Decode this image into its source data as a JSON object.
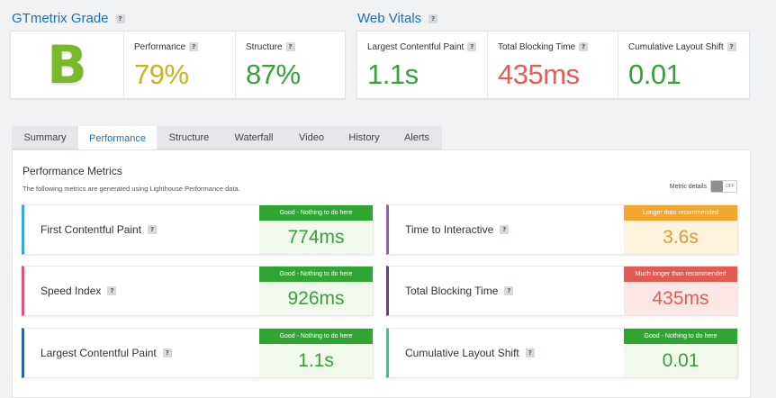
{
  "grade_section": {
    "title": "GTmetrix Grade",
    "help": "?",
    "grade": "B",
    "performance": {
      "label": "Performance",
      "value": "79%"
    },
    "structure": {
      "label": "Structure",
      "value": "87%"
    }
  },
  "web_vitals": {
    "title": "Web Vitals",
    "help": "?",
    "lcp": {
      "label": "Largest Contentful Paint",
      "value": "1.1s"
    },
    "tbt": {
      "label": "Total Blocking Time",
      "value": "435ms"
    },
    "cls": {
      "label": "Cumulative Layout Shift",
      "value": "0.01"
    }
  },
  "tabs": [
    {
      "label": "Summary",
      "active": false
    },
    {
      "label": "Performance",
      "active": true
    },
    {
      "label": "Structure",
      "active": false
    },
    {
      "label": "Waterfall",
      "active": false
    },
    {
      "label": "Video",
      "active": false
    },
    {
      "label": "History",
      "active": false
    },
    {
      "label": "Alerts",
      "active": false
    }
  ],
  "panel": {
    "title": "Performance Metrics",
    "description": "The following metrics are generated using Lighthouse Performance data.",
    "metric_details_label": "Metric details",
    "toggle_state": "OFF"
  },
  "metrics": [
    {
      "name": "First Contentful Paint",
      "status": "Good - Nothing to do here",
      "value": "774ms",
      "accent": "#3aa6dd",
      "level": "good"
    },
    {
      "name": "Time to Interactive",
      "status": "Longer than recommended",
      "value": "3.6s",
      "accent": "#9b59b6",
      "level": "warn"
    },
    {
      "name": "Speed Index",
      "status": "Good - Nothing to do here",
      "value": "926ms",
      "accent": "#e2527f",
      "level": "good"
    },
    {
      "name": "Total Blocking Time",
      "status": "Much longer than recommended",
      "value": "435ms",
      "accent": "#6a3f7d",
      "level": "bad"
    },
    {
      "name": "Largest Contentful Paint",
      "status": "Good - Nothing to do here",
      "value": "1.1s",
      "accent": "#2e5fae",
      "level": "good"
    },
    {
      "name": "Cumulative Layout Shift",
      "status": "Good - Nothing to do here",
      "value": "0.01",
      "accent": "#3dbf9c",
      "level": "good"
    }
  ],
  "colors": {
    "brand_blue": "#1f6fb0",
    "good": "#37a13a",
    "warning": "#f0a630",
    "bad": "#e25f55",
    "grade": "#78b82a"
  }
}
